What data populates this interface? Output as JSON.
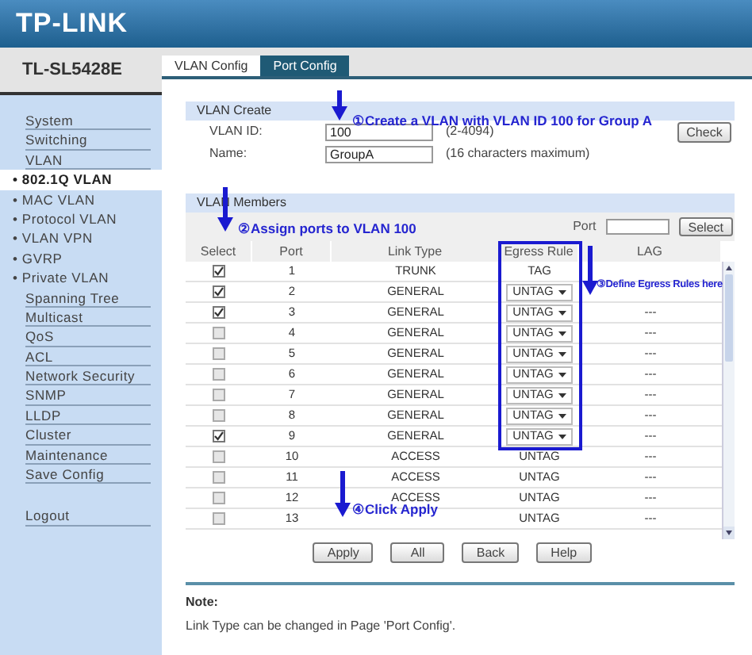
{
  "header": {
    "logo": "TP-LINK"
  },
  "sidebar": {
    "model": "TL-SL5428E",
    "items": [
      {
        "label": "System",
        "selected": false
      },
      {
        "label": "Switching",
        "selected": false
      },
      {
        "label": "VLAN",
        "selected": false,
        "children": [
          {
            "label": "• 802.1Q VLAN",
            "selected": true
          },
          {
            "label": "• MAC VLAN",
            "selected": false
          },
          {
            "label": "• Protocol VLAN",
            "selected": false
          },
          {
            "label": "• VLAN VPN",
            "selected": false
          },
          {
            "label": "• GVRP",
            "selected": false
          },
          {
            "label": "• Private VLAN",
            "selected": false
          }
        ]
      },
      {
        "label": "Spanning Tree",
        "selected": false
      },
      {
        "label": "Multicast",
        "selected": false
      },
      {
        "label": "QoS",
        "selected": false
      },
      {
        "label": "ACL",
        "selected": false
      },
      {
        "label": "Network Security",
        "selected": false
      },
      {
        "label": "SNMP",
        "selected": false
      },
      {
        "label": "LLDP",
        "selected": false
      },
      {
        "label": "Cluster",
        "selected": false
      },
      {
        "label": "Maintenance",
        "selected": false
      },
      {
        "label": "Save Config",
        "selected": false
      }
    ],
    "logout": "Logout"
  },
  "tabs": [
    {
      "label": "VLAN Config",
      "selected": true
    },
    {
      "label": "Port Config",
      "selected": false
    }
  ],
  "vlan_create": {
    "title": "VLAN Create",
    "fields": [
      {
        "label": "VLAN ID:",
        "value": "100",
        "hint": "(2-4094)"
      },
      {
        "label": "Name:",
        "value": "GroupA",
        "hint": "(16 characters maximum)"
      }
    ],
    "check_button": "Check"
  },
  "vlan_members": {
    "title": "VLAN Members",
    "port_label": "Port",
    "select_button": "Select",
    "columns": [
      "Select",
      "Port",
      "Link Type",
      "Egress Rule",
      "LAG"
    ],
    "rows": [
      {
        "checked": true,
        "port": "1",
        "link_type": "TRUNK",
        "kind": "text",
        "egress": "TAG"
      },
      {
        "checked": true,
        "port": "2",
        "link_type": "GENERAL",
        "kind": "select",
        "egress": "UNTAG"
      },
      {
        "checked": true,
        "port": "3",
        "link_type": "GENERAL",
        "kind": "select",
        "egress": "UNTAG",
        "lag": "---"
      },
      {
        "checked": false,
        "port": "4",
        "link_type": "GENERAL",
        "kind": "select",
        "egress": "UNTAG",
        "lag": "---"
      },
      {
        "checked": false,
        "port": "5",
        "link_type": "GENERAL",
        "kind": "select",
        "egress": "UNTAG",
        "lag": "---"
      },
      {
        "checked": false,
        "port": "6",
        "link_type": "GENERAL",
        "kind": "select",
        "egress": "UNTAG",
        "lag": "---"
      },
      {
        "checked": false,
        "port": "7",
        "link_type": "GENERAL",
        "kind": "select",
        "egress": "UNTAG",
        "lag": "---"
      },
      {
        "checked": false,
        "port": "8",
        "link_type": "GENERAL",
        "kind": "select",
        "egress": "UNTAG",
        "lag": "---"
      },
      {
        "checked": true,
        "port": "9",
        "link_type": "GENERAL",
        "kind": "select",
        "egress": "UNTAG",
        "lag": "---"
      },
      {
        "checked": false,
        "port": "10",
        "link_type": "ACCESS",
        "kind": "text",
        "egress": "UNTAG",
        "lag": "---"
      },
      {
        "checked": false,
        "port": "11",
        "link_type": "ACCESS",
        "kind": "text",
        "egress": "UNTAG",
        "lag": "---"
      },
      {
        "checked": false,
        "port": "12",
        "link_type": "ACCESS",
        "kind": "text",
        "egress": "UNTAG",
        "lag": "---"
      },
      {
        "checked": false,
        "port": "13",
        "kind": "text",
        "egress": "UNTAG",
        "lag": "---"
      }
    ]
  },
  "buttons": [
    "Apply",
    "All",
    "Back",
    "Help"
  ],
  "note": {
    "title": "Note:",
    "text": "Link Type can be changed in Page 'Port Config'."
  },
  "annotations": [
    {
      "text": "①Create a VLAN with VLAN ID 100 for Group A"
    },
    {
      "text": "②Assign ports to VLAN 100"
    },
    {
      "text": "③Define Egress Rules here"
    },
    {
      "text": "④Click Apply"
    }
  ]
}
